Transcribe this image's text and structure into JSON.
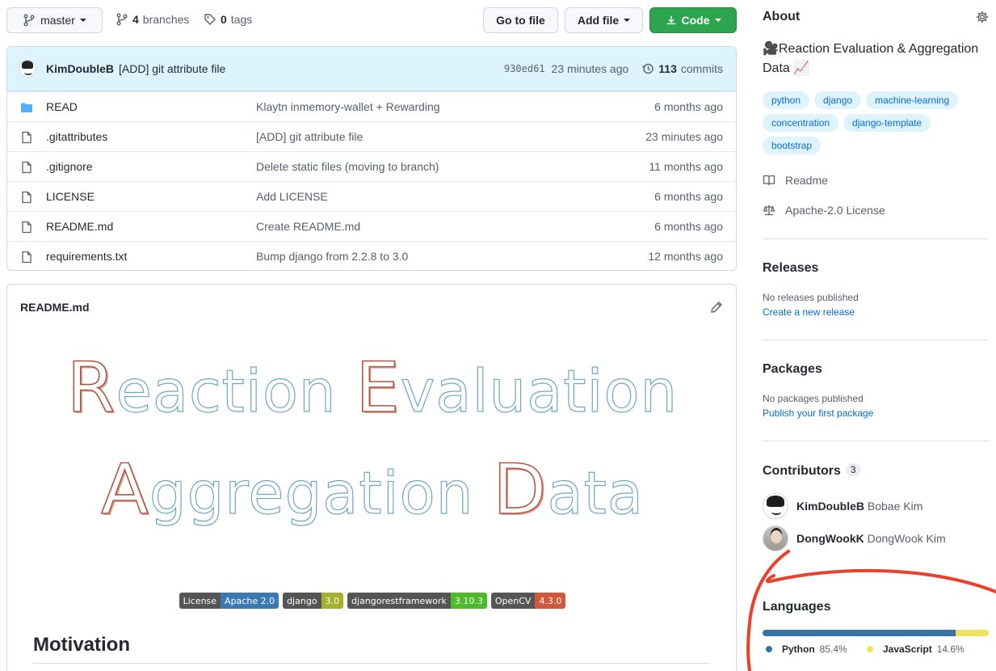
{
  "toolbar": {
    "branch": "master",
    "branches_count": "4",
    "branches_label": "branches",
    "tags_count": "0",
    "tags_label": "tags",
    "go_to_file": "Go to file",
    "add_file": "Add file",
    "code": "Code"
  },
  "commit": {
    "author": "KimDoubleB",
    "message": "[ADD] git attribute file",
    "sha": "930ed61",
    "age": "23 minutes ago",
    "commits_count": "113",
    "commits_label": "commits"
  },
  "files": [
    {
      "name": "READ",
      "type": "folder",
      "message": "Klaytn inmemory-wallet + Rewarding",
      "age": "6 months ago"
    },
    {
      "name": ".gitattributes",
      "type": "file",
      "message": "[ADD] git attribute file",
      "age": "23 minutes ago"
    },
    {
      "name": ".gitignore",
      "type": "file",
      "message": "Delete static files (moving to branch)",
      "age": "11 months ago"
    },
    {
      "name": "LICENSE",
      "type": "file",
      "message": "Add LICENSE",
      "age": "6 months ago"
    },
    {
      "name": "README.md",
      "type": "file",
      "message": "Create README.md",
      "age": "6 months ago"
    },
    {
      "name": "requirements.txt",
      "type": "file",
      "message": "Bump django from 2.2.8 to 3.0",
      "age": "12 months ago"
    }
  ],
  "readme": {
    "title": "README.md",
    "banner_line1_cap1": "R",
    "banner_line1_rest1": "eaction ",
    "banner_line1_cap2": "E",
    "banner_line1_rest2": "valuation",
    "banner_line2_cap1": "A",
    "banner_line2_rest1": "ggregation ",
    "banner_line2_cap2": "D",
    "banner_line2_rest2": "ata",
    "badges": [
      {
        "label": "License",
        "value": "Apache 2.0",
        "color": "#3a79b4"
      },
      {
        "label": "django",
        "value": "3.0",
        "color": "#a4b22b"
      },
      {
        "label": "djangorestframework",
        "value": "3.10.3",
        "color": "#4dba2a"
      },
      {
        "label": "OpenCV",
        "value": "4.3.0",
        "color": "#d3573a"
      }
    ],
    "heading": "Motivation"
  },
  "about": {
    "title": "About",
    "description": "🎥Reaction Evaluation & Aggregation Data 📈",
    "topics": [
      "python",
      "django",
      "machine-learning",
      "concentration",
      "django-template",
      "bootstrap"
    ],
    "readme_link": "Readme",
    "license_link": "Apache-2.0 License"
  },
  "releases": {
    "title": "Releases",
    "status": "No releases published",
    "link": "Create a new release"
  },
  "packages": {
    "title": "Packages",
    "status": "No packages published",
    "link": "Publish your first package"
  },
  "contributors": {
    "title": "Contributors",
    "count": "3",
    "people": [
      {
        "login": "KimDoubleB",
        "name": "Bobae Kim"
      },
      {
        "login": "DongWookK",
        "name": "DongWook Kim"
      }
    ]
  },
  "languages": {
    "title": "Languages",
    "items": [
      {
        "name": "Python",
        "percent": "85.4%",
        "value": 85.4,
        "color": "#3572A5"
      },
      {
        "name": "JavaScript",
        "percent": "14.6%",
        "value": 14.6,
        "color": "#f1e05a"
      }
    ]
  },
  "colors": {
    "accent_link": "#0969da",
    "code_button": "#2da44e",
    "annotation_red": "#e8412c"
  }
}
